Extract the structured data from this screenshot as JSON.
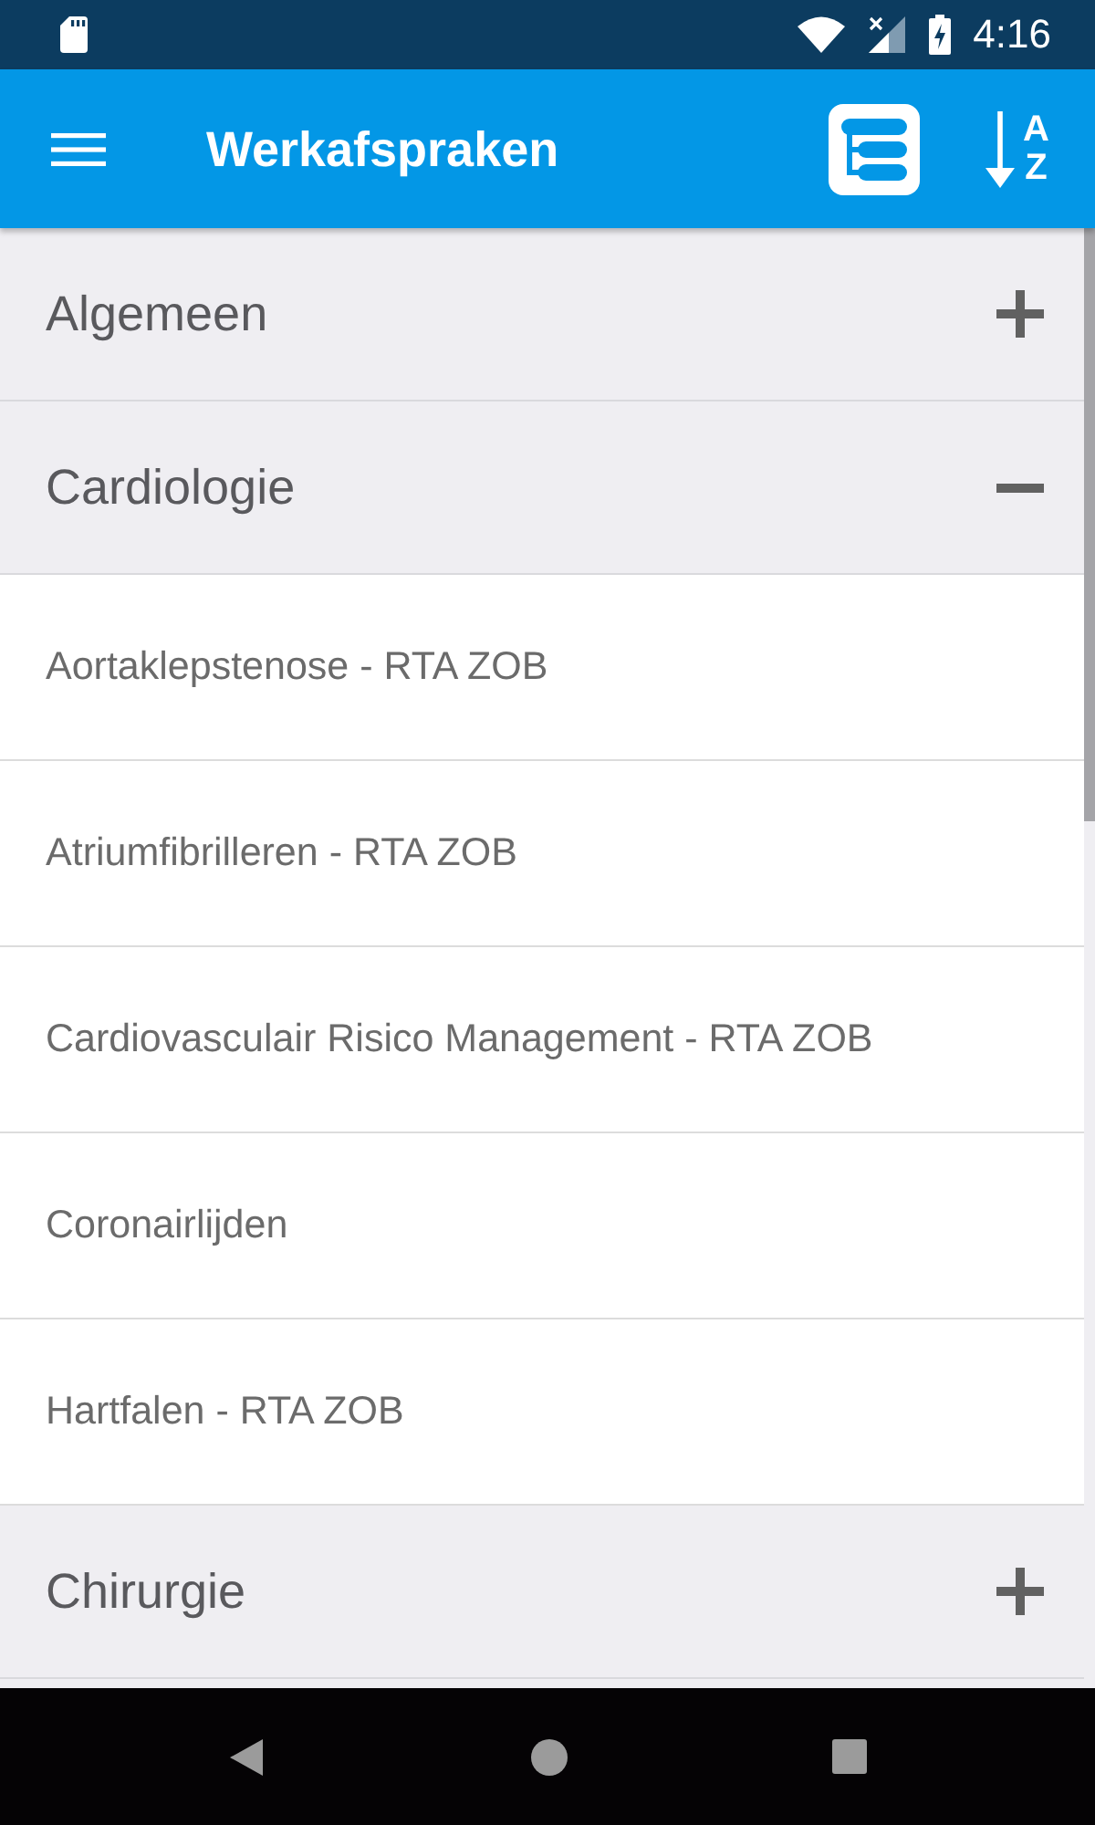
{
  "status_bar": {
    "time": "4:16"
  },
  "app_bar": {
    "title": "Werkafspraken",
    "sort_letters": [
      "A",
      "Z"
    ]
  },
  "groups": [
    {
      "title": "Algemeen",
      "expanded": false
    },
    {
      "title": "Cardiologie",
      "expanded": true,
      "items": [
        "Aortaklepstenose - RTA ZOB",
        "Atriumfibrilleren - RTA ZOB",
        "Cardiovasculair Risico Management - RTA ZOB",
        "Coronairlijden",
        "Hartfalen - RTA ZOB"
      ]
    },
    {
      "title": "Chirurgie",
      "expanded": false
    }
  ]
}
